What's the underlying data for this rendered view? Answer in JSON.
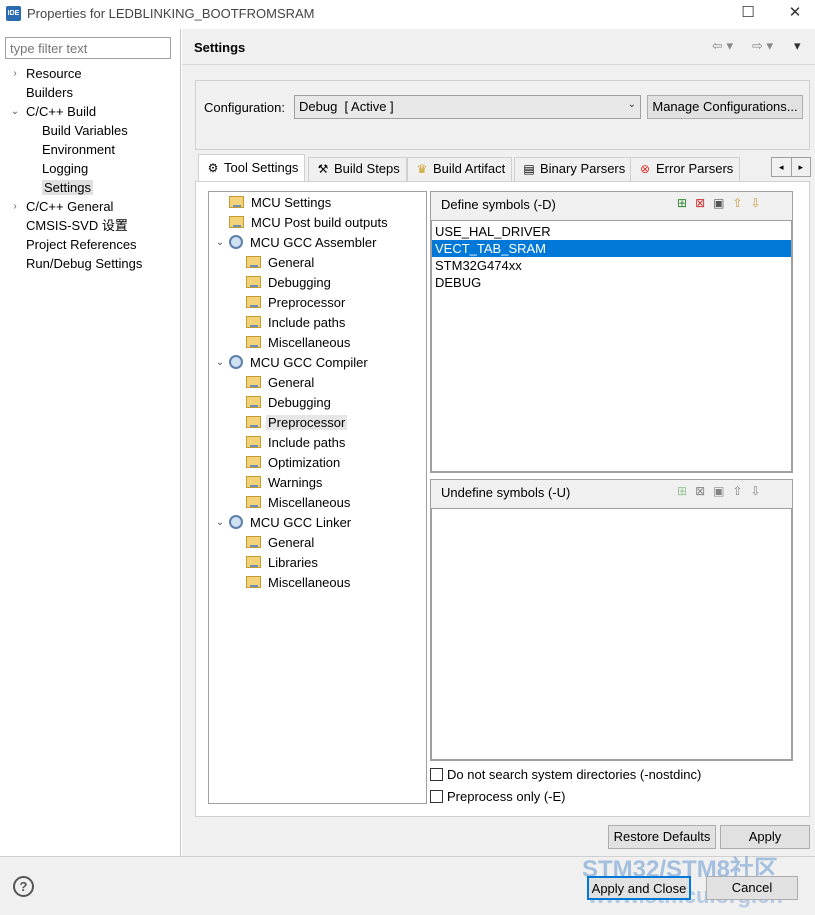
{
  "window": {
    "app_icon_text": "IDE",
    "title": "Properties for LEDBLINKING_BOOTFROMSRAM"
  },
  "filter": {
    "placeholder": "type filter text"
  },
  "nav": [
    {
      "label": "Resource",
      "level": 0,
      "twisty": "›"
    },
    {
      "label": "Builders",
      "level": 0
    },
    {
      "label": "C/C++ Build",
      "level": 0,
      "twisty": "⌄"
    },
    {
      "label": "Build Variables",
      "level": 1
    },
    {
      "label": "Environment",
      "level": 1
    },
    {
      "label": "Logging",
      "level": 1
    },
    {
      "label": "Settings",
      "level": 1,
      "selected": true
    },
    {
      "label": "C/C++ General",
      "level": 0,
      "twisty": "›"
    },
    {
      "label": "CMSIS-SVD 设置",
      "level": 0
    },
    {
      "label": "Project References",
      "level": 0
    },
    {
      "label": "Run/Debug Settings",
      "level": 0
    }
  ],
  "page": {
    "title": "Settings"
  },
  "config": {
    "label": "Configuration:",
    "value": "Debug  [ Active ]",
    "manage_label": "Manage Configurations..."
  },
  "tabs": [
    {
      "label": "Tool Settings",
      "icon": "gear-icon"
    },
    {
      "label": "Build Steps",
      "icon": "build-icon"
    },
    {
      "label": "Build Artifact",
      "icon": "trophy-icon"
    },
    {
      "label": "Binary Parsers",
      "icon": "parser-icon"
    },
    {
      "label": "Error Parsers",
      "icon": "error-icon"
    }
  ],
  "tool_tree": [
    {
      "label": "MCU Settings",
      "level": 0,
      "icon": "folder"
    },
    {
      "label": "MCU Post build outputs",
      "level": 0,
      "icon": "folder"
    },
    {
      "label": "MCU GCC Assembler",
      "level": 0,
      "icon": "gear",
      "twisty": "⌄"
    },
    {
      "label": "General",
      "level": 1,
      "icon": "folder"
    },
    {
      "label": "Debugging",
      "level": 1,
      "icon": "folder"
    },
    {
      "label": "Preprocessor",
      "level": 1,
      "icon": "folder"
    },
    {
      "label": "Include paths",
      "level": 1,
      "icon": "folder"
    },
    {
      "label": "Miscellaneous",
      "level": 1,
      "icon": "folder"
    },
    {
      "label": "MCU GCC Compiler",
      "level": 0,
      "icon": "gear",
      "twisty": "⌄"
    },
    {
      "label": "General",
      "level": 1,
      "icon": "folder"
    },
    {
      "label": "Debugging",
      "level": 1,
      "icon": "folder"
    },
    {
      "label": "Preprocessor",
      "level": 1,
      "icon": "folder",
      "selected": true
    },
    {
      "label": "Include paths",
      "level": 1,
      "icon": "folder"
    },
    {
      "label": "Optimization",
      "level": 1,
      "icon": "folder"
    },
    {
      "label": "Warnings",
      "level": 1,
      "icon": "folder"
    },
    {
      "label": "Miscellaneous",
      "level": 1,
      "icon": "folder"
    },
    {
      "label": "MCU GCC Linker",
      "level": 0,
      "icon": "gear",
      "twisty": "⌄"
    },
    {
      "label": "General",
      "level": 1,
      "icon": "folder"
    },
    {
      "label": "Libraries",
      "level": 1,
      "icon": "folder"
    },
    {
      "label": "Miscellaneous",
      "level": 1,
      "icon": "folder"
    }
  ],
  "define_symbols": {
    "title": "Define symbols (-D)",
    "items": [
      "USE_HAL_DRIVER",
      "VECT_TAB_SRAM",
      "STM32G474xx",
      "DEBUG"
    ],
    "selected": "VECT_TAB_SRAM"
  },
  "undefine_symbols": {
    "title": "Undefine symbols (-U)",
    "items": []
  },
  "options": {
    "nostdinc": "Do not search system directories (-nostdinc)",
    "preprocess_only": "Preprocess only (-E)"
  },
  "buttons": {
    "restore_defaults": "Restore Defaults",
    "apply": "Apply",
    "apply_and_close": "Apply and Close",
    "cancel": "Cancel"
  },
  "watermark": {
    "line1": "STM32/STM8社区",
    "line2": "www.stmcu.org.cn"
  },
  "colors": {
    "selection": "#0078d7",
    "panel_bg": "#f0f0f0"
  }
}
